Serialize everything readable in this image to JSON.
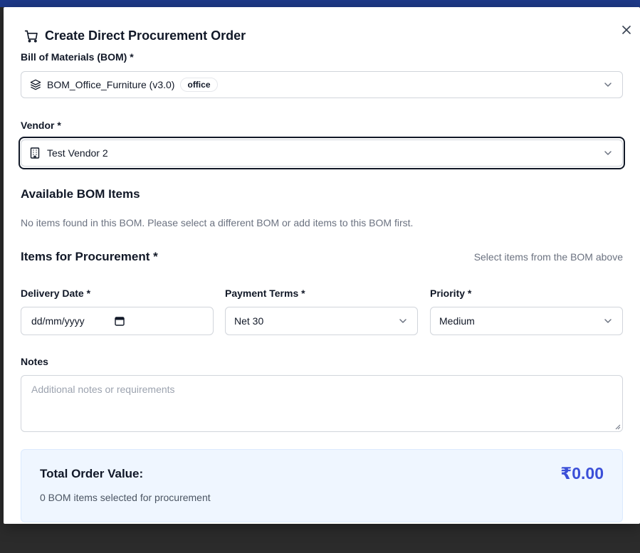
{
  "modal": {
    "title": "Create Direct Procurement Order"
  },
  "bom": {
    "label": "Bill of Materials (BOM) *",
    "value": "BOM_Office_Furniture (v3.0)",
    "badge": "office"
  },
  "vendor": {
    "label": "Vendor *",
    "value": "Test Vendor 2"
  },
  "available": {
    "heading": "Available BOM Items",
    "empty_message": "No items found in this BOM. Please select a different BOM or add items to this BOM first."
  },
  "procurement": {
    "heading": "Items for Procurement *",
    "hint": "Select items from the BOM above"
  },
  "delivery": {
    "label": "Delivery Date *",
    "placeholder": "dd/mm/yyyy"
  },
  "payment": {
    "label": "Payment Terms *",
    "value": "Net 30"
  },
  "priority": {
    "label": "Priority *",
    "value": "Medium"
  },
  "notes": {
    "label": "Notes",
    "placeholder": "Additional notes or requirements"
  },
  "total": {
    "label": "Total Order Value:",
    "value": "₹0.00",
    "summary": "0 BOM items selected for procurement"
  },
  "colors": {
    "accent": "#3b4fd8",
    "total_bg": "#eff6ff",
    "topbar": "#1e3a8a"
  }
}
